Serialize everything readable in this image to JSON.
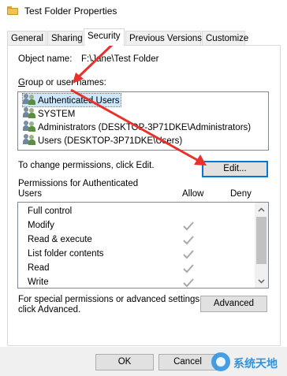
{
  "window": {
    "title": "Test Folder Properties",
    "title_icon": "folder-icon"
  },
  "tabs": [
    {
      "label": "General",
      "active": false
    },
    {
      "label": "Sharing",
      "active": false
    },
    {
      "label": "Security",
      "active": true
    },
    {
      "label": "Previous Versions",
      "active": false
    },
    {
      "label": "Customize",
      "active": false
    }
  ],
  "security": {
    "object_name_label": "Object name:",
    "object_name_value": "F:\\Jane\\Test Folder",
    "group_label": "Group or user names:",
    "groups": [
      {
        "name": "Authenticated Users",
        "icon": "users-icon",
        "selected": true
      },
      {
        "name": "SYSTEM",
        "icon": "users-icon",
        "selected": false
      },
      {
        "name": "Administrators (DESKTOP-3P71DKE\\Administrators)",
        "icon": "users-icon",
        "selected": false
      },
      {
        "name": "Users (DESKTOP-3P71DKE\\Users)",
        "icon": "users-icon",
        "selected": false
      }
    ],
    "change_text": "To change permissions, click Edit.",
    "edit_button": "Edit...",
    "permissions_label_line1": "Permissions for Authenticated",
    "permissions_label_line2": "Users",
    "allow_header": "Allow",
    "deny_header": "Deny",
    "permissions": [
      {
        "name": "Full control",
        "allow": false
      },
      {
        "name": "Modify",
        "allow": true
      },
      {
        "name": "Read & execute",
        "allow": true
      },
      {
        "name": "List folder contents",
        "allow": true
      },
      {
        "name": "Read",
        "allow": true
      },
      {
        "name": "Write",
        "allow": true
      }
    ],
    "special_text_line1": "For special permissions or advanced settings,",
    "special_text_line2": "click Advanced.",
    "advanced_button": "Advanced"
  },
  "footer": {
    "ok_button": "OK",
    "cancel_button": "Cancel"
  },
  "watermark": {
    "text": "系统天地"
  },
  "colors": {
    "selection": "#cce8ff",
    "arrow": "#e8312a",
    "focus": "#0078d7",
    "check": "#a9a9a9"
  }
}
